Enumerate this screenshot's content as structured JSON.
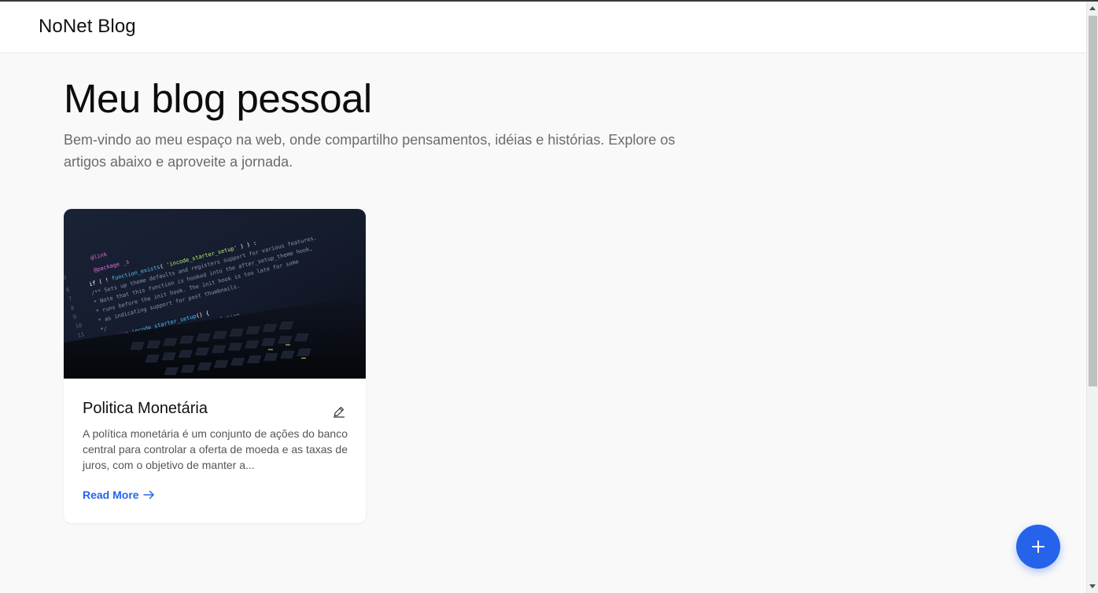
{
  "header": {
    "brand": "NoNet Blog"
  },
  "hero": {
    "title": "Meu blog pessoal",
    "subtitle": "Bem-vindo ao meu espaço na web, onde compartilho pensamentos, idéias e histórias. Explore os artigos abaixo e aproveite a jornada."
  },
  "posts": [
    {
      "title": "Politica Monetária",
      "excerpt": "A política monetária é um conjunto de ações do banco central para controlar a oferta de moeda e as taxas de juros, com o objetivo de manter a...",
      "read_more": "Read More",
      "image_icon": "code-laptop-photo",
      "edit_icon": "pencil-icon"
    }
  ],
  "fab": {
    "icon": "plus-icon"
  },
  "colors": {
    "accent": "#2563eb",
    "background": "#f9f9f9",
    "card": "#ffffff"
  }
}
